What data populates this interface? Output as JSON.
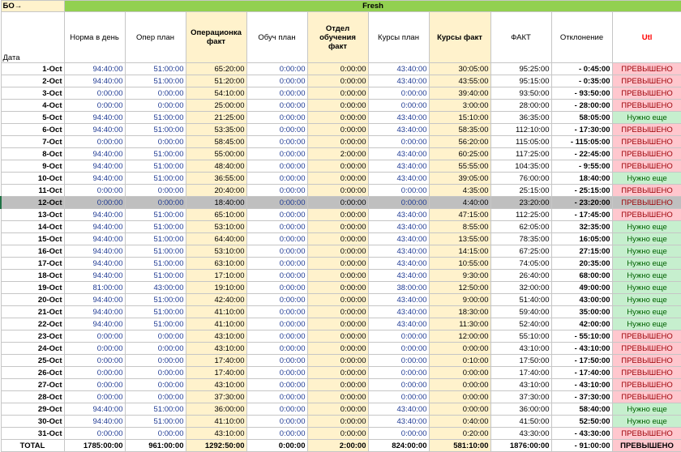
{
  "header": {
    "bo_label": "БО→",
    "group_label": "Fresh",
    "date": "Дата",
    "norm": "Норма в день",
    "oper_plan": "Опер план",
    "oper_fact": "Операционка факт",
    "obuch_plan": "Обуч план",
    "dept_fact": "Отдел обучения факт",
    "courses_plan": "Курсы план",
    "courses_fact": "Курсы факт",
    "fact": "ФАКТ",
    "deviation": "Отклонение",
    "utl": "Utl"
  },
  "rows": [
    [
      "1-Oct",
      "94:40:00",
      "51:00:00",
      "65:20:00",
      "0:00:00",
      "0:00:00",
      "43:40:00",
      "30:05:00",
      "95:25:00",
      "- 0:45:00",
      "ПРЕВЫШЕНО"
    ],
    [
      "2-Oct",
      "94:40:00",
      "51:00:00",
      "51:20:00",
      "0:00:00",
      "0:00:00",
      "43:40:00",
      "43:55:00",
      "95:15:00",
      "- 0:35:00",
      "ПРЕВЫШЕНО"
    ],
    [
      "3-Oct",
      "0:00:00",
      "0:00:00",
      "54:10:00",
      "0:00:00",
      "0:00:00",
      "0:00:00",
      "39:40:00",
      "93:50:00",
      "- 93:50:00",
      "ПРЕВЫШЕНО"
    ],
    [
      "4-Oct",
      "0:00:00",
      "0:00:00",
      "25:00:00",
      "0:00:00",
      "0:00:00",
      "0:00:00",
      "3:00:00",
      "28:00:00",
      "- 28:00:00",
      "ПРЕВЫШЕНО"
    ],
    [
      "5-Oct",
      "94:40:00",
      "51:00:00",
      "21:25:00",
      "0:00:00",
      "0:00:00",
      "43:40:00",
      "15:10:00",
      "36:35:00",
      "58:05:00",
      "Нужно еще"
    ],
    [
      "6-Oct",
      "94:40:00",
      "51:00:00",
      "53:35:00",
      "0:00:00",
      "0:00:00",
      "43:40:00",
      "58:35:00",
      "112:10:00",
      "- 17:30:00",
      "ПРЕВЫШЕНО"
    ],
    [
      "7-Oct",
      "0:00:00",
      "0:00:00",
      "58:45:00",
      "0:00:00",
      "0:00:00",
      "0:00:00",
      "56:20:00",
      "115:05:00",
      "- 115:05:00",
      "ПРЕВЫШЕНО"
    ],
    [
      "8-Oct",
      "94:40:00",
      "51:00:00",
      "55:00:00",
      "0:00:00",
      "2:00:00",
      "43:40:00",
      "60:25:00",
      "117:25:00",
      "- 22:45:00",
      "ПРЕВЫШЕНО"
    ],
    [
      "9-Oct",
      "94:40:00",
      "51:00:00",
      "48:40:00",
      "0:00:00",
      "0:00:00",
      "43:40:00",
      "55:55:00",
      "104:35:00",
      "- 9:55:00",
      "ПРЕВЫШЕНО"
    ],
    [
      "10-Oct",
      "94:40:00",
      "51:00:00",
      "36:55:00",
      "0:00:00",
      "0:00:00",
      "43:40:00",
      "39:05:00",
      "76:00:00",
      "18:40:00",
      "Нужно еще"
    ],
    [
      "11-Oct",
      "0:00:00",
      "0:00:00",
      "20:40:00",
      "0:00:00",
      "0:00:00",
      "0:00:00",
      "4:35:00",
      "25:15:00",
      "- 25:15:00",
      "ПРЕВЫШЕНО"
    ],
    [
      "12-Oct",
      "0:00:00",
      "0:00:00",
      "18:40:00",
      "0:00:00",
      "0:00:00",
      "0:00:00",
      "4:40:00",
      "23:20:00",
      "- 23:20:00",
      "ПРЕВЫШЕНО"
    ],
    [
      "13-Oct",
      "94:40:00",
      "51:00:00",
      "65:10:00",
      "0:00:00",
      "0:00:00",
      "43:40:00",
      "47:15:00",
      "112:25:00",
      "- 17:45:00",
      "ПРЕВЫШЕНО"
    ],
    [
      "14-Oct",
      "94:40:00",
      "51:00:00",
      "53:10:00",
      "0:00:00",
      "0:00:00",
      "43:40:00",
      "8:55:00",
      "62:05:00",
      "32:35:00",
      "Нужно еще"
    ],
    [
      "15-Oct",
      "94:40:00",
      "51:00:00",
      "64:40:00",
      "0:00:00",
      "0:00:00",
      "43:40:00",
      "13:55:00",
      "78:35:00",
      "16:05:00",
      "Нужно еще"
    ],
    [
      "16-Oct",
      "94:40:00",
      "51:00:00",
      "53:10:00",
      "0:00:00",
      "0:00:00",
      "43:40:00",
      "14:15:00",
      "67:25:00",
      "27:15:00",
      "Нужно еще"
    ],
    [
      "17-Oct",
      "94:40:00",
      "51:00:00",
      "63:10:00",
      "0:00:00",
      "0:00:00",
      "43:40:00",
      "10:55:00",
      "74:05:00",
      "20:35:00",
      "Нужно еще"
    ],
    [
      "18-Oct",
      "94:40:00",
      "51:00:00",
      "17:10:00",
      "0:00:00",
      "0:00:00",
      "43:40:00",
      "9:30:00",
      "26:40:00",
      "68:00:00",
      "Нужно еще"
    ],
    [
      "19-Oct",
      "81:00:00",
      "43:00:00",
      "19:10:00",
      "0:00:00",
      "0:00:00",
      "38:00:00",
      "12:50:00",
      "32:00:00",
      "49:00:00",
      "Нужно еще"
    ],
    [
      "20-Oct",
      "94:40:00",
      "51:00:00",
      "42:40:00",
      "0:00:00",
      "0:00:00",
      "43:40:00",
      "9:00:00",
      "51:40:00",
      "43:00:00",
      "Нужно еще"
    ],
    [
      "21-Oct",
      "94:40:00",
      "51:00:00",
      "41:10:00",
      "0:00:00",
      "0:00:00",
      "43:40:00",
      "18:30:00",
      "59:40:00",
      "35:00:00",
      "Нужно еще"
    ],
    [
      "22-Oct",
      "94:40:00",
      "51:00:00",
      "41:10:00",
      "0:00:00",
      "0:00:00",
      "43:40:00",
      "11:30:00",
      "52:40:00",
      "42:00:00",
      "Нужно еще"
    ],
    [
      "23-Oct",
      "0:00:00",
      "0:00:00",
      "43:10:00",
      "0:00:00",
      "0:00:00",
      "0:00:00",
      "12:00:00",
      "55:10:00",
      "- 55:10:00",
      "ПРЕВЫШЕНО"
    ],
    [
      "24-Oct",
      "0:00:00",
      "0:00:00",
      "43:10:00",
      "0:00:00",
      "0:00:00",
      "0:00:00",
      "0:00:00",
      "43:10:00",
      "- 43:10:00",
      "ПРЕВЫШЕНО"
    ],
    [
      "25-Oct",
      "0:00:00",
      "0:00:00",
      "17:40:00",
      "0:00:00",
      "0:00:00",
      "0:00:00",
      "0:10:00",
      "17:50:00",
      "- 17:50:00",
      "ПРЕВЫШЕНО"
    ],
    [
      "26-Oct",
      "0:00:00",
      "0:00:00",
      "17:40:00",
      "0:00:00",
      "0:00:00",
      "0:00:00",
      "0:00:00",
      "17:40:00",
      "- 17:40:00",
      "ПРЕВЫШЕНО"
    ],
    [
      "27-Oct",
      "0:00:00",
      "0:00:00",
      "43:10:00",
      "0:00:00",
      "0:00:00",
      "0:00:00",
      "0:00:00",
      "43:10:00",
      "- 43:10:00",
      "ПРЕВЫШЕНО"
    ],
    [
      "28-Oct",
      "0:00:00",
      "0:00:00",
      "37:30:00",
      "0:00:00",
      "0:00:00",
      "0:00:00",
      "0:00:00",
      "37:30:00",
      "- 37:30:00",
      "ПРЕВЫШЕНО"
    ],
    [
      "29-Oct",
      "94:40:00",
      "51:00:00",
      "36:00:00",
      "0:00:00",
      "0:00:00",
      "43:40:00",
      "0:00:00",
      "36:00:00",
      "58:40:00",
      "Нужно еще"
    ],
    [
      "30-Oct",
      "94:40:00",
      "51:00:00",
      "41:10:00",
      "0:00:00",
      "0:00:00",
      "43:40:00",
      "0:40:00",
      "41:50:00",
      "52:50:00",
      "Нужно еще"
    ],
    [
      "31-Oct",
      "0:00:00",
      "0:00:00",
      "43:10:00",
      "0:00:00",
      "0:00:00",
      "0:00:00",
      "0:20:00",
      "43:30:00",
      "- 43:30:00",
      "ПРЕВЫШЕНО"
    ]
  ],
  "total": [
    "TOTAL",
    "1785:00:00",
    "961:00:00",
    "1292:50:00",
    "0:00:00",
    "2:00:00",
    "824:00:00",
    "581:10:00",
    "1876:00:00",
    "- 91:00:00",
    "ПРЕВЫШЕНО"
  ],
  "selected_row": 11,
  "colors": {
    "header_green": "#92d050",
    "fact_highlight": "#fff2cc",
    "status_over_bg": "#ffc7ce",
    "status_need_bg": "#c6efce"
  }
}
